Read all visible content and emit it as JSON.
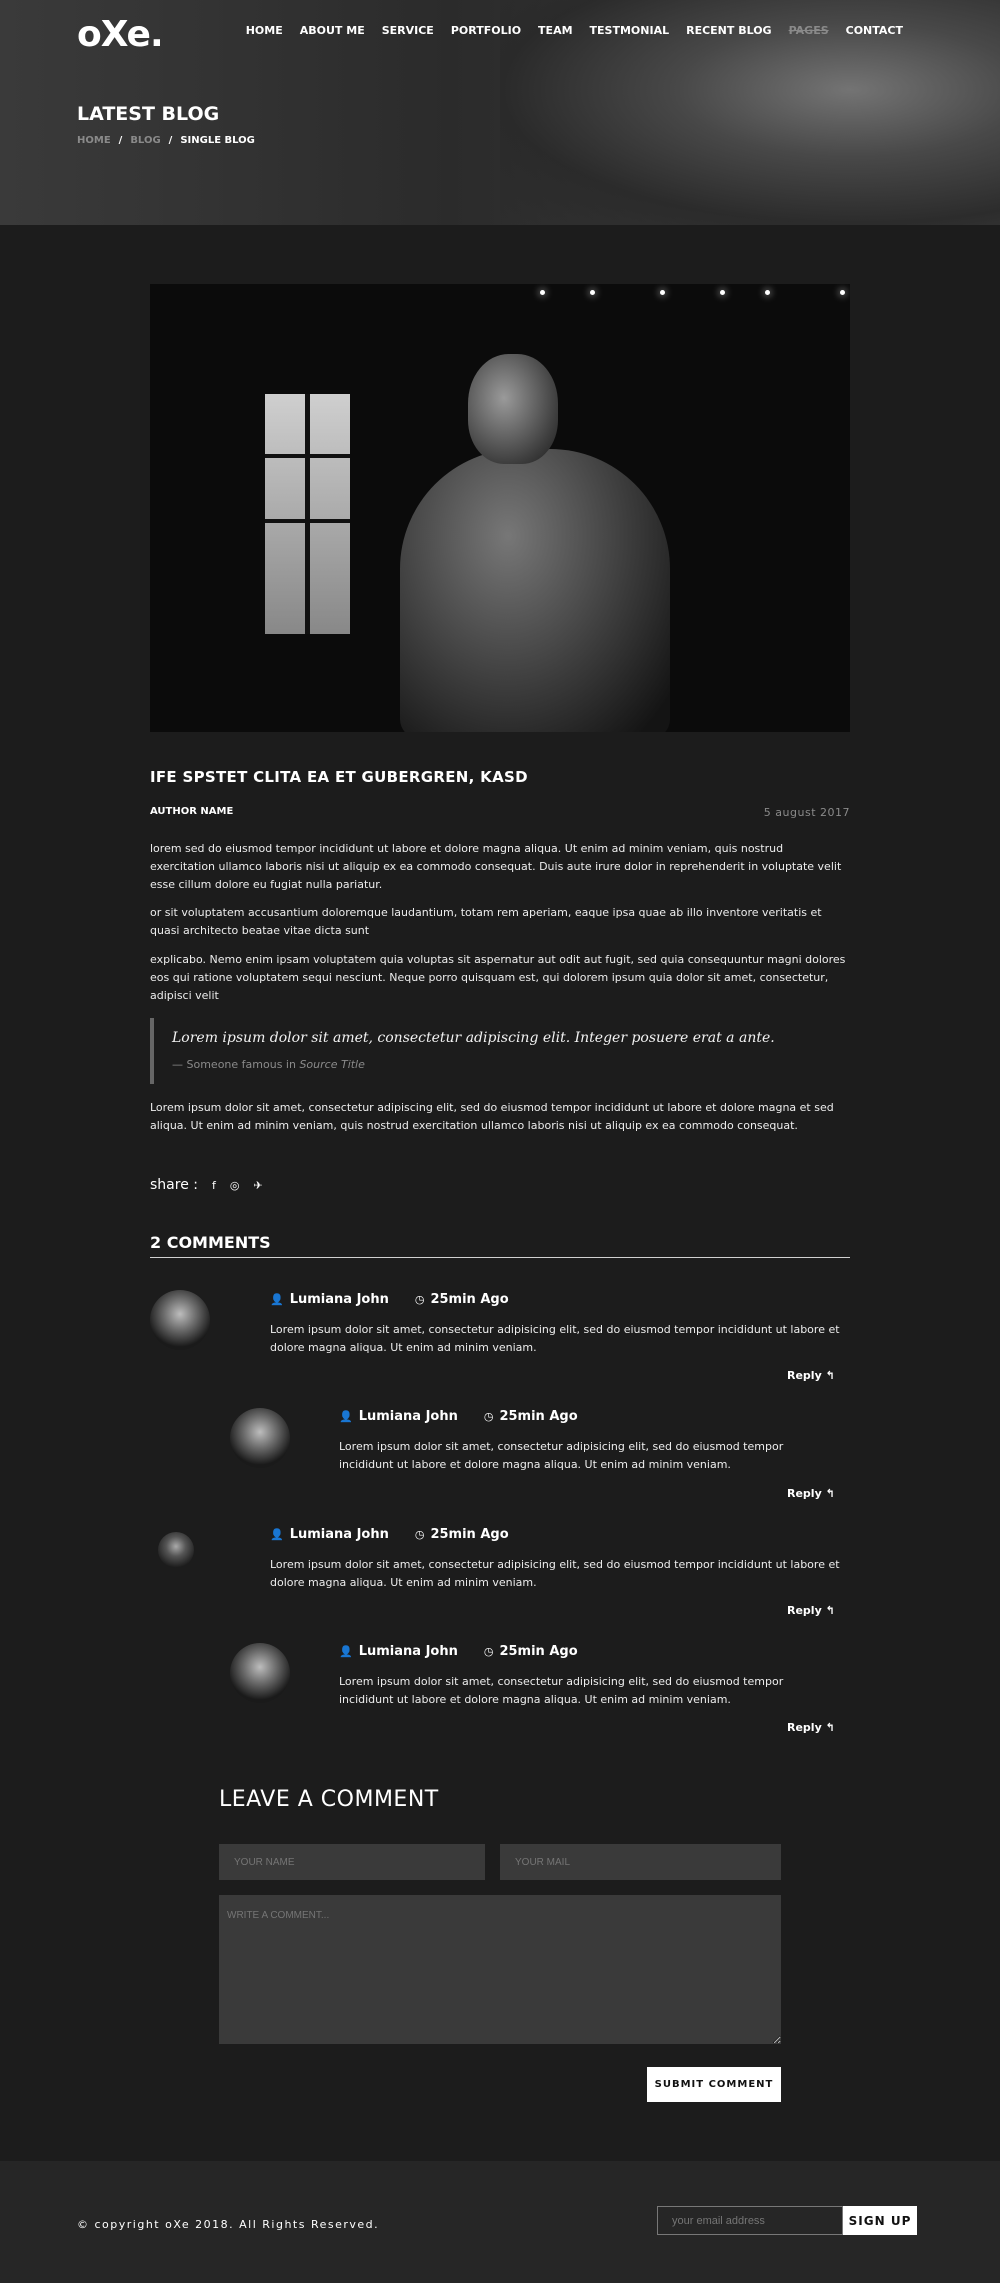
{
  "header": {
    "logo": "oXe.",
    "nav": [
      "HOME",
      "ABOUT ME",
      "SERVICE",
      "PORTFOLIO",
      "TEAM",
      "TESTMONIAL",
      "RECENT BLOG",
      "PAGES",
      "CONTACT"
    ],
    "title": "LATEST BLOG",
    "breadcrumb": {
      "home": "HOME",
      "blog": "BLOG",
      "current": "SINGLE BLOG",
      "separator": "/"
    }
  },
  "post": {
    "title": "IFE SPSTET CLITA EA ET GUBERGREN, KASD",
    "author": "AUTHOR NAME",
    "date": "5 august 2017",
    "paragraphs": [
      "lorem sed do eiusmod tempor incididunt ut labore et dolore magna aliqua. Ut enim ad minim veniam, quis nostrud exercitation ullamco laboris nisi ut aliquip ex ea commodo consequat. Duis aute irure dolor in reprehenderit in voluptate velit esse cillum dolore eu fugiat nulla pariatur.",
      "or sit voluptatem accusantium doloremque laudantium, totam rem aperiam, eaque ipsa quae ab illo inventore veritatis et quasi architecto beatae vitae dicta sunt",
      "explicabo. Nemo enim ipsam voluptatem quia voluptas sit aspernatur aut odit aut fugit, sed quia consequuntur magni dolores eos qui ratione voluptatem sequi nesciunt. Neque porro quisquam est, qui dolorem ipsum quia dolor sit amet, consectetur, adipisci velit",
      "Lorem ipsum dolor sit amet, consectetur adipiscing elit, sed do eiusmod tempor incididunt ut labore et dolore magna et sed aliqua. Ut enim ad minim veniam, quis nostrud exercitation ullamco laboris nisi ut aliquip ex ea commodo consequat."
    ],
    "quote": {
      "text": "Lorem ipsum dolor sit amet, consectetur adipiscing elit. Integer posuere erat a ante.",
      "source_prefix": "— Someone famous in",
      "source_title": "Source Title"
    },
    "share_label": "share :",
    "share_icons": [
      "facebook-icon",
      "instagram-icon",
      "twitter-icon"
    ]
  },
  "comments": {
    "heading": "2 COMMENTS",
    "items": [
      {
        "name": "Lumiana John",
        "time": "25min Ago",
        "text": "Lorem ipsum dolor sit amet, consectetur adipisicing elit, sed do eiusmod tempor incididunt ut labore et dolore magna aliqua. Ut enim ad minim veniam.",
        "reply": "Reply"
      },
      {
        "name": "Lumiana John",
        "time": "25min Ago",
        "text": "Lorem ipsum dolor sit amet, consectetur adipisicing elit, sed do eiusmod tempor incididunt ut labore et dolore magna aliqua. Ut enim ad minim veniam.",
        "reply": "Reply"
      },
      {
        "name": "Lumiana John",
        "time": "25min Ago",
        "text": "Lorem ipsum dolor sit amet, consectetur adipisicing elit, sed do eiusmod tempor incididunt ut labore et dolore magna aliqua. Ut enim ad minim veniam.",
        "reply": "Reply"
      },
      {
        "name": "Lumiana John",
        "time": "25min Ago",
        "text": "Lorem ipsum dolor sit amet, consectetur adipisicing elit, sed do eiusmod tempor incididunt ut labore et dolore magna aliqua. Ut enim ad minim veniam.",
        "reply": "Reply"
      }
    ]
  },
  "form": {
    "heading": "LEAVE A COMMENT",
    "name_placeholder": "YOUR NAME",
    "mail_placeholder": "YOUR MAIL",
    "comment_placeholder": "WRITE A COMMENT...",
    "submit": "SUBMIT COMMENT"
  },
  "footer": {
    "copyright": "© copyright oXe 2018. All Rights Reserved.",
    "email_placeholder": "your email address",
    "signup": "SIGN UP"
  }
}
